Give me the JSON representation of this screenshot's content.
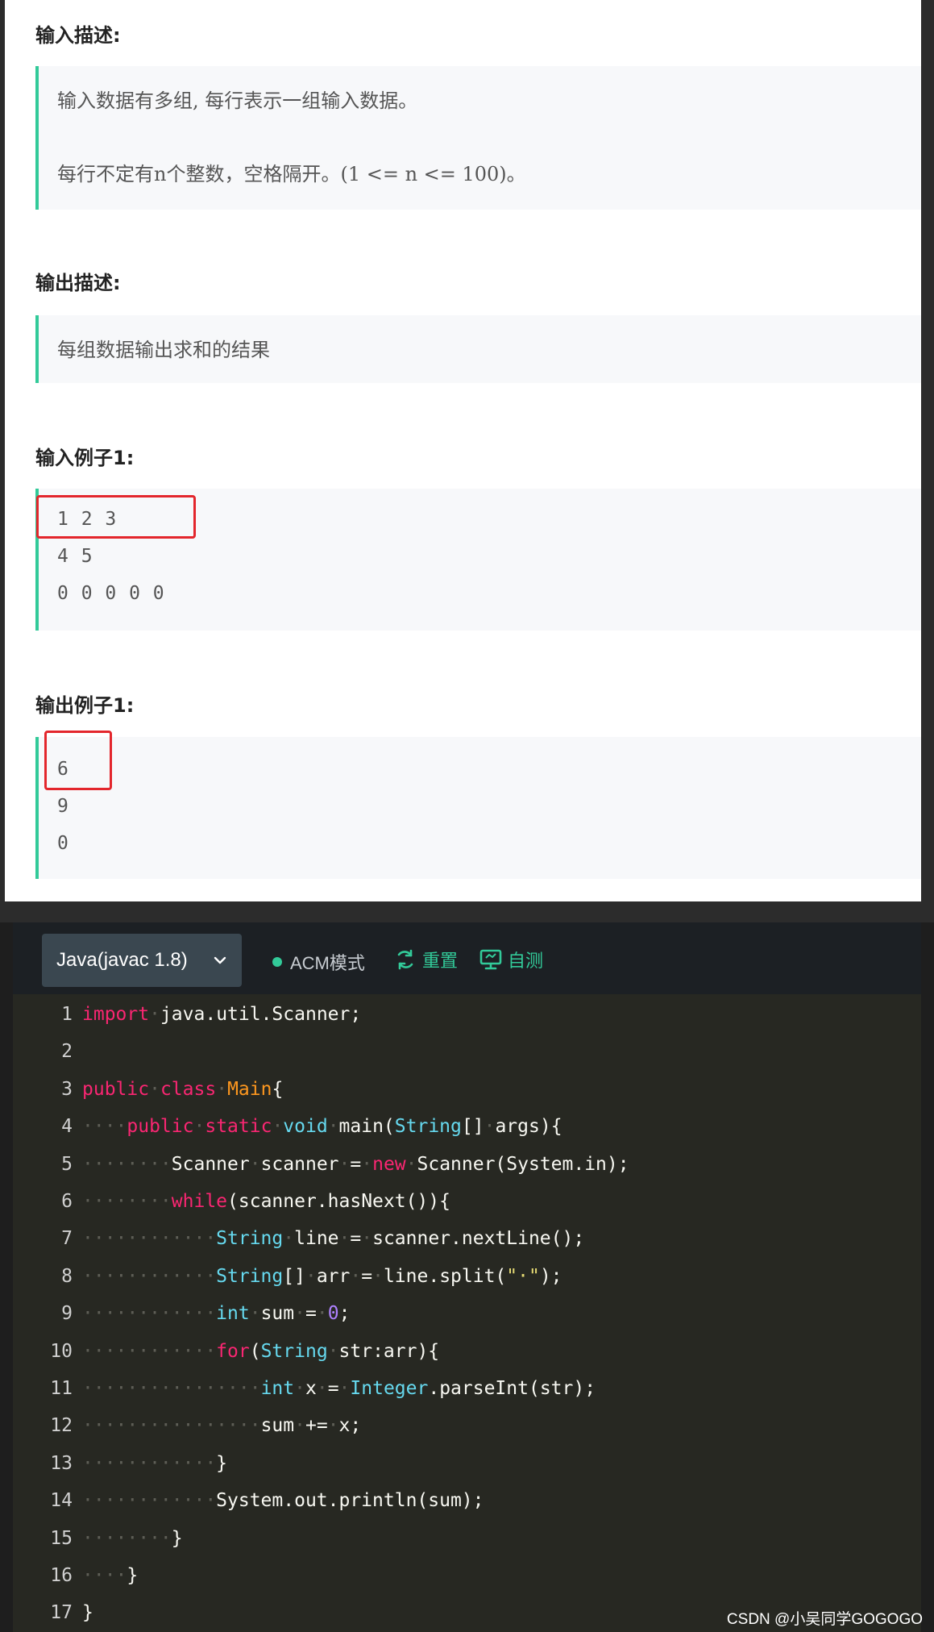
{
  "problem": {
    "input_desc_title": "输入描述:",
    "input_desc_lines": [
      "输入数据有多组, 每行表示一组输入数据。",
      "每行不定有n个整数，空格隔开。(1 <= n <= 100)。"
    ],
    "output_desc_title": "输出描述:",
    "output_desc_lines": [
      "每组数据输出求和的结果"
    ],
    "input_example_title": "输入例子1:",
    "input_example_lines": [
      "1 2 3",
      "4 5",
      "0 0 0 0 0"
    ],
    "output_example_title": "输出例子1:",
    "output_example_lines": [
      "6",
      "9",
      "0"
    ]
  },
  "editor": {
    "language": "Java(javac 1.8)",
    "mode_label": "ACM模式",
    "reset_label": "重置",
    "self_test_label": "自测",
    "accent_color": "#32ca99",
    "lines": [
      {
        "no": "1",
        "tokens": [
          [
            "kw",
            "import"
          ],
          [
            "ws",
            "·"
          ],
          [
            "txt",
            "java.util.Scanner;"
          ]
        ]
      },
      {
        "no": "2",
        "tokens": []
      },
      {
        "no": "3",
        "tokens": [
          [
            "kw",
            "public"
          ],
          [
            "ws",
            "·"
          ],
          [
            "kw",
            "class"
          ],
          [
            "ws",
            "·"
          ],
          [
            "cls",
            "Main"
          ],
          [
            "txt",
            "{"
          ]
        ]
      },
      {
        "no": "4",
        "tokens": [
          [
            "ws",
            "····"
          ],
          [
            "kw",
            "public"
          ],
          [
            "ws",
            "·"
          ],
          [
            "kw",
            "static"
          ],
          [
            "ws",
            "·"
          ],
          [
            "type",
            "void"
          ],
          [
            "ws",
            "·"
          ],
          [
            "txt",
            "main("
          ],
          [
            "type",
            "String"
          ],
          [
            "txt",
            "[]"
          ],
          [
            "ws",
            "·"
          ],
          [
            "txt",
            "args){"
          ]
        ]
      },
      {
        "no": "5",
        "tokens": [
          [
            "ws",
            "········"
          ],
          [
            "txt",
            "Scanner"
          ],
          [
            "ws",
            "·"
          ],
          [
            "txt",
            "scanner"
          ],
          [
            "ws",
            "·"
          ],
          [
            "txt",
            "="
          ],
          [
            "ws",
            "·"
          ],
          [
            "kw",
            "new"
          ],
          [
            "ws",
            "·"
          ],
          [
            "txt",
            "Scanner(System.in);"
          ]
        ]
      },
      {
        "no": "6",
        "tokens": [
          [
            "ws",
            "········"
          ],
          [
            "kw",
            "while"
          ],
          [
            "txt",
            "(scanner.hasNext()){"
          ]
        ]
      },
      {
        "no": "7",
        "tokens": [
          [
            "ws",
            "············"
          ],
          [
            "type",
            "String"
          ],
          [
            "ws",
            "·"
          ],
          [
            "txt",
            "line"
          ],
          [
            "ws",
            "·"
          ],
          [
            "txt",
            "="
          ],
          [
            "ws",
            "·"
          ],
          [
            "txt",
            "scanner.nextLine();"
          ]
        ]
      },
      {
        "no": "8",
        "tokens": [
          [
            "ws",
            "············"
          ],
          [
            "type",
            "String"
          ],
          [
            "txt",
            "[]"
          ],
          [
            "ws",
            "·"
          ],
          [
            "txt",
            "arr"
          ],
          [
            "ws",
            "·"
          ],
          [
            "txt",
            "="
          ],
          [
            "ws",
            "·"
          ],
          [
            "txt",
            "line.split("
          ],
          [
            "str",
            "\"·\""
          ],
          [
            "txt",
            ");"
          ]
        ]
      },
      {
        "no": "9",
        "tokens": [
          [
            "ws",
            "············"
          ],
          [
            "type",
            "int"
          ],
          [
            "ws",
            "·"
          ],
          [
            "txt",
            "sum"
          ],
          [
            "ws",
            "·"
          ],
          [
            "txt",
            "="
          ],
          [
            "ws",
            "·"
          ],
          [
            "num",
            "0"
          ],
          [
            "txt",
            ";"
          ]
        ]
      },
      {
        "no": "10",
        "tokens": [
          [
            "ws",
            "············"
          ],
          [
            "kw",
            "for"
          ],
          [
            "txt",
            "("
          ],
          [
            "type",
            "String"
          ],
          [
            "ws",
            "·"
          ],
          [
            "txt",
            "str:arr){"
          ]
        ]
      },
      {
        "no": "11",
        "tokens": [
          [
            "ws",
            "················"
          ],
          [
            "type",
            "int"
          ],
          [
            "ws",
            "·"
          ],
          [
            "txt",
            "x"
          ],
          [
            "ws",
            "·"
          ],
          [
            "txt",
            "="
          ],
          [
            "ws",
            "·"
          ],
          [
            "type",
            "Integer"
          ],
          [
            "txt",
            ".parseInt(str);"
          ]
        ]
      },
      {
        "no": "12",
        "tokens": [
          [
            "ws",
            "················"
          ],
          [
            "txt",
            "sum"
          ],
          [
            "ws",
            "·"
          ],
          [
            "txt",
            "+="
          ],
          [
            "ws",
            "·"
          ],
          [
            "txt",
            "x;"
          ]
        ]
      },
      {
        "no": "13",
        "tokens": [
          [
            "ws",
            "············"
          ],
          [
            "txt",
            "}"
          ]
        ]
      },
      {
        "no": "14",
        "tokens": [
          [
            "ws",
            "············"
          ],
          [
            "txt",
            "System.out.println(sum);"
          ]
        ]
      },
      {
        "no": "15",
        "tokens": [
          [
            "ws",
            "········"
          ],
          [
            "txt",
            "}"
          ]
        ]
      },
      {
        "no": "16",
        "tokens": [
          [
            "ws",
            "····"
          ],
          [
            "txt",
            "}"
          ]
        ]
      },
      {
        "no": "17",
        "tokens": [
          [
            "txt",
            "}"
          ]
        ]
      }
    ]
  },
  "watermark": "CSDN @小吴同学GOGOGO"
}
